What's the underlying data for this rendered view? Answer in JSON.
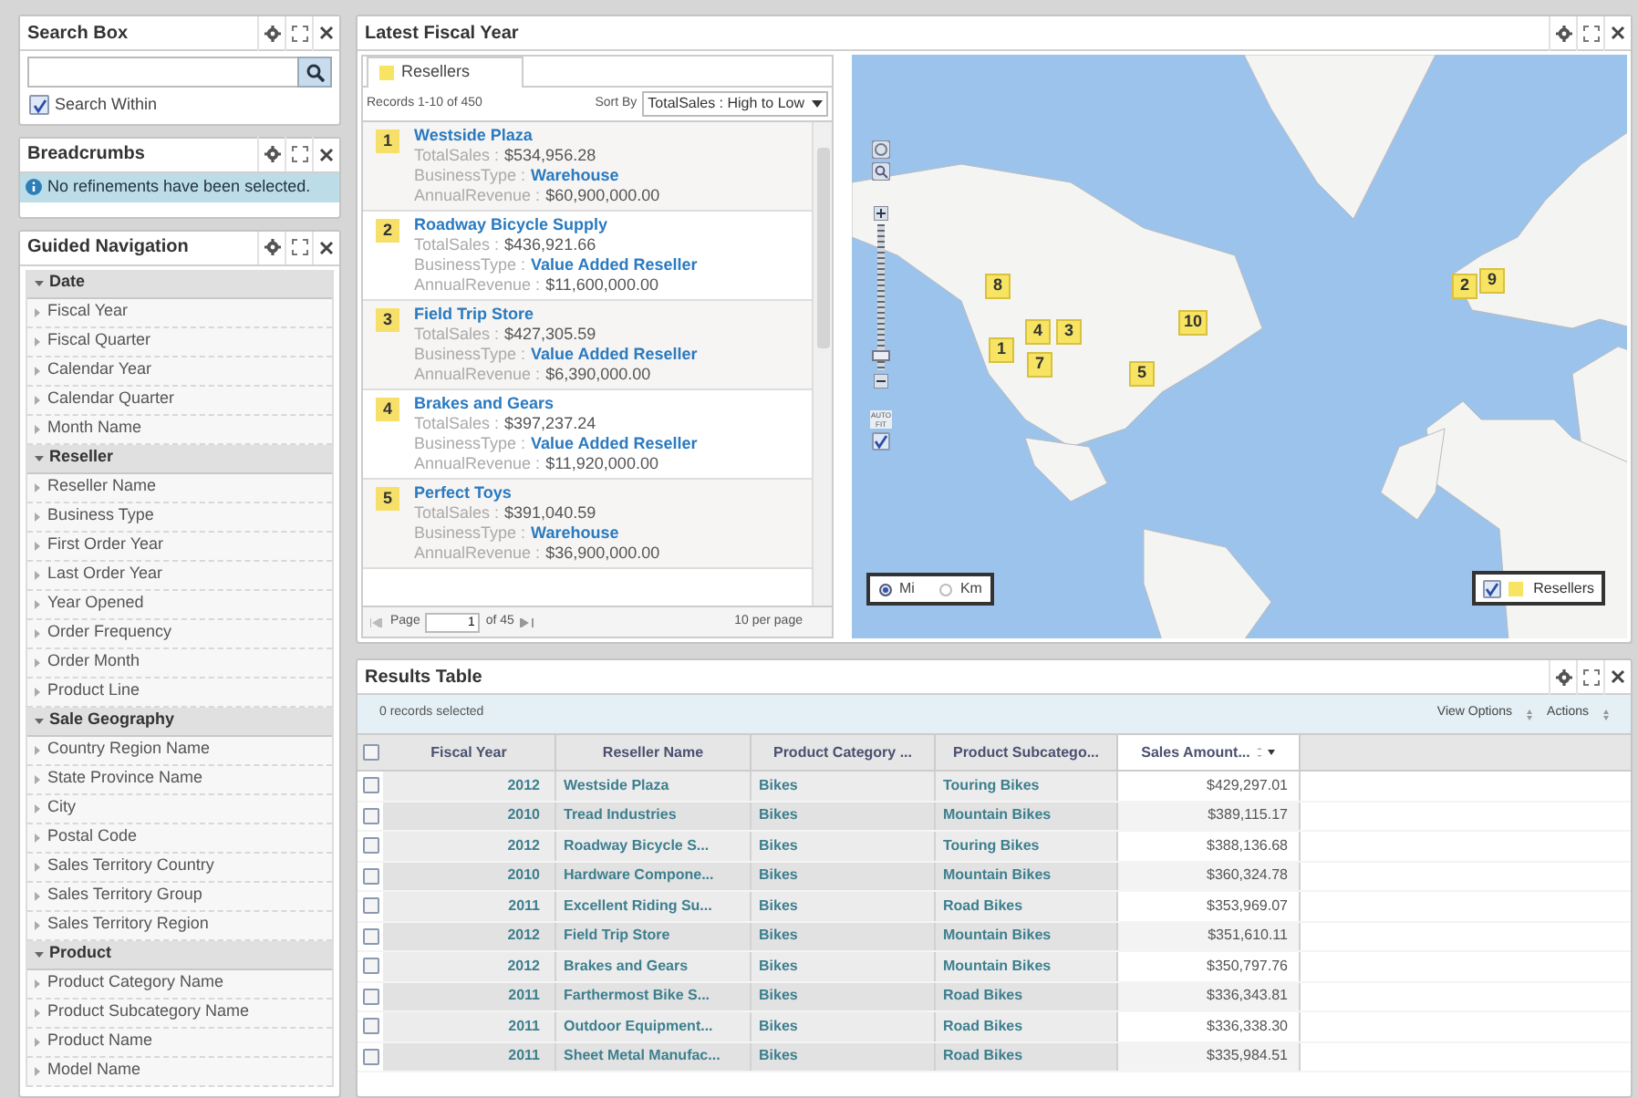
{
  "search_box": {
    "title": "Search Box",
    "search_within": {
      "label": "Search Within",
      "checked": true
    }
  },
  "breadcrumbs": {
    "title": "Breadcrumbs",
    "message": "No refinements have been selected."
  },
  "guided_navigation": {
    "title": "Guided Navigation",
    "groups": [
      {
        "label": "Date",
        "expanded": true,
        "children": [
          {
            "label": "Fiscal Year"
          },
          {
            "label": "Fiscal Quarter"
          },
          {
            "label": "Calendar Year"
          },
          {
            "label": "Calendar Quarter"
          },
          {
            "label": "Month Name"
          }
        ]
      },
      {
        "label": "Reseller",
        "expanded": true,
        "children": [
          {
            "label": "Reseller Name"
          },
          {
            "label": "Business Type"
          },
          {
            "label": "First Order Year"
          },
          {
            "label": "Last Order Year"
          },
          {
            "label": "Year Opened"
          },
          {
            "label": "Order Frequency"
          },
          {
            "label": "Order Month"
          },
          {
            "label": "Product Line"
          }
        ]
      },
      {
        "label": "Sale Geography",
        "expanded": true,
        "children": [
          {
            "label": "Country Region Name"
          },
          {
            "label": "State Province Name"
          },
          {
            "label": "City"
          },
          {
            "label": "Postal Code"
          },
          {
            "label": "Sales Territory Country"
          },
          {
            "label": "Sales Territory Group"
          },
          {
            "label": "Sales Territory Region"
          }
        ]
      },
      {
        "label": "Product",
        "expanded": true,
        "children": [
          {
            "label": "Product Category Name"
          },
          {
            "label": "Product Subcategory Name"
          },
          {
            "label": "Product Name"
          },
          {
            "label": "Model Name"
          }
        ]
      }
    ]
  },
  "latest_fiscal_year": {
    "title": "Latest Fiscal Year",
    "tabs": [
      {
        "label": "Resellers",
        "selected": true,
        "color": "#f7e463"
      }
    ],
    "records_info": "Records 1-10 of 450",
    "sort_label": "Sort By",
    "sort_value": "TotalSales : High to Low",
    "records": [
      {
        "rank": "1",
        "name": "Westside Plaza",
        "fields": [
          {
            "label": "TotalSales :",
            "value": "$534,956.28",
            "kind": "text"
          },
          {
            "label": "BusinessType :",
            "value": "Warehouse",
            "kind": "link"
          },
          {
            "label": "AnnualRevenue :",
            "value": "$60,900,000.00",
            "kind": "text"
          }
        ]
      },
      {
        "rank": "2",
        "name": "Roadway Bicycle Supply",
        "fields": [
          {
            "label": "TotalSales :",
            "value": "$436,921.66",
            "kind": "text"
          },
          {
            "label": "BusinessType :",
            "value": "Value Added Reseller",
            "kind": "link"
          },
          {
            "label": "AnnualRevenue :",
            "value": "$11,600,000.00",
            "kind": "text"
          }
        ]
      },
      {
        "rank": "3",
        "name": "Field Trip Store",
        "fields": [
          {
            "label": "TotalSales :",
            "value": "$427,305.59",
            "kind": "text"
          },
          {
            "label": "BusinessType :",
            "value": "Value Added Reseller",
            "kind": "link"
          },
          {
            "label": "AnnualRevenue :",
            "value": "$6,390,000.00",
            "kind": "text"
          }
        ]
      },
      {
        "rank": "4",
        "name": "Brakes and Gears",
        "fields": [
          {
            "label": "TotalSales :",
            "value": "$397,237.24",
            "kind": "text"
          },
          {
            "label": "BusinessType :",
            "value": "Value Added Reseller",
            "kind": "link"
          },
          {
            "label": "AnnualRevenue :",
            "value": "$11,920,000.00",
            "kind": "text"
          }
        ]
      },
      {
        "rank": "5",
        "name": "Perfect Toys",
        "fields": [
          {
            "label": "TotalSales :",
            "value": "$391,040.59",
            "kind": "text"
          },
          {
            "label": "BusinessType :",
            "value": "Warehouse",
            "kind": "link"
          },
          {
            "label": "AnnualRevenue :",
            "value": "$36,900,000.00",
            "kind": "text"
          }
        ]
      }
    ],
    "pager": {
      "page_label": "Page",
      "page": "1",
      "of_pages": "of 45",
      "per_page": "10 per page"
    },
    "map": {
      "markers": [
        "8",
        "2",
        "9",
        "10",
        "4",
        "3",
        "1",
        "7",
        "5"
      ],
      "zoom": {
        "level": 0.1
      },
      "auto_fit": {
        "label": "AUTO FIT",
        "checked": true
      },
      "units": [
        {
          "label": "Mi",
          "selected": true
        },
        {
          "label": "Km",
          "selected": false
        }
      ],
      "legend": {
        "label": "Resellers",
        "checked": true,
        "color": "#f7e463"
      }
    }
  },
  "results_table": {
    "title": "Results Table",
    "select_all_checked": false,
    "selection_info": "0 records selected",
    "actions": [
      "View Options",
      "Actions"
    ],
    "columns": [
      {
        "label": "Fiscal Year",
        "sorted": false
      },
      {
        "label": "Reseller Name",
        "sorted": false
      },
      {
        "label": "Product Category ...",
        "sorted": false
      },
      {
        "label": "Product Subcatego...",
        "sorted": false
      },
      {
        "label": "Sales Amount...",
        "sorted": true
      }
    ],
    "rows": [
      {
        "checked": false,
        "cells": [
          "2012",
          "Westside Plaza",
          "Bikes",
          "Touring Bikes",
          "$429,297.01"
        ]
      },
      {
        "checked": false,
        "cells": [
          "2010",
          "Tread Industries",
          "Bikes",
          "Mountain Bikes",
          "$389,115.17"
        ]
      },
      {
        "checked": false,
        "cells": [
          "2012",
          "Roadway Bicycle S...",
          "Bikes",
          "Touring Bikes",
          "$388,136.68"
        ]
      },
      {
        "checked": false,
        "cells": [
          "2010",
          "Hardware Compone...",
          "Bikes",
          "Mountain Bikes",
          "$360,324.78"
        ]
      },
      {
        "checked": false,
        "cells": [
          "2011",
          "Excellent Riding Su...",
          "Bikes",
          "Road Bikes",
          "$353,969.07"
        ]
      },
      {
        "checked": false,
        "cells": [
          "2012",
          "Field Trip Store",
          "Bikes",
          "Mountain Bikes",
          "$351,610.11"
        ]
      },
      {
        "checked": false,
        "cells": [
          "2012",
          "Brakes and Gears",
          "Bikes",
          "Mountain Bikes",
          "$350,797.76"
        ]
      },
      {
        "checked": false,
        "cells": [
          "2011",
          "Farthermost Bike S...",
          "Bikes",
          "Road Bikes",
          "$336,343.81"
        ]
      },
      {
        "checked": false,
        "cells": [
          "2011",
          "Outdoor Equipment...",
          "Bikes",
          "Road Bikes",
          "$336,338.30"
        ]
      },
      {
        "checked": false,
        "cells": [
          "2011",
          "Sheet Metal Manufac...",
          "Bikes",
          "Road Bikes",
          "$335,984.51"
        ]
      }
    ]
  }
}
